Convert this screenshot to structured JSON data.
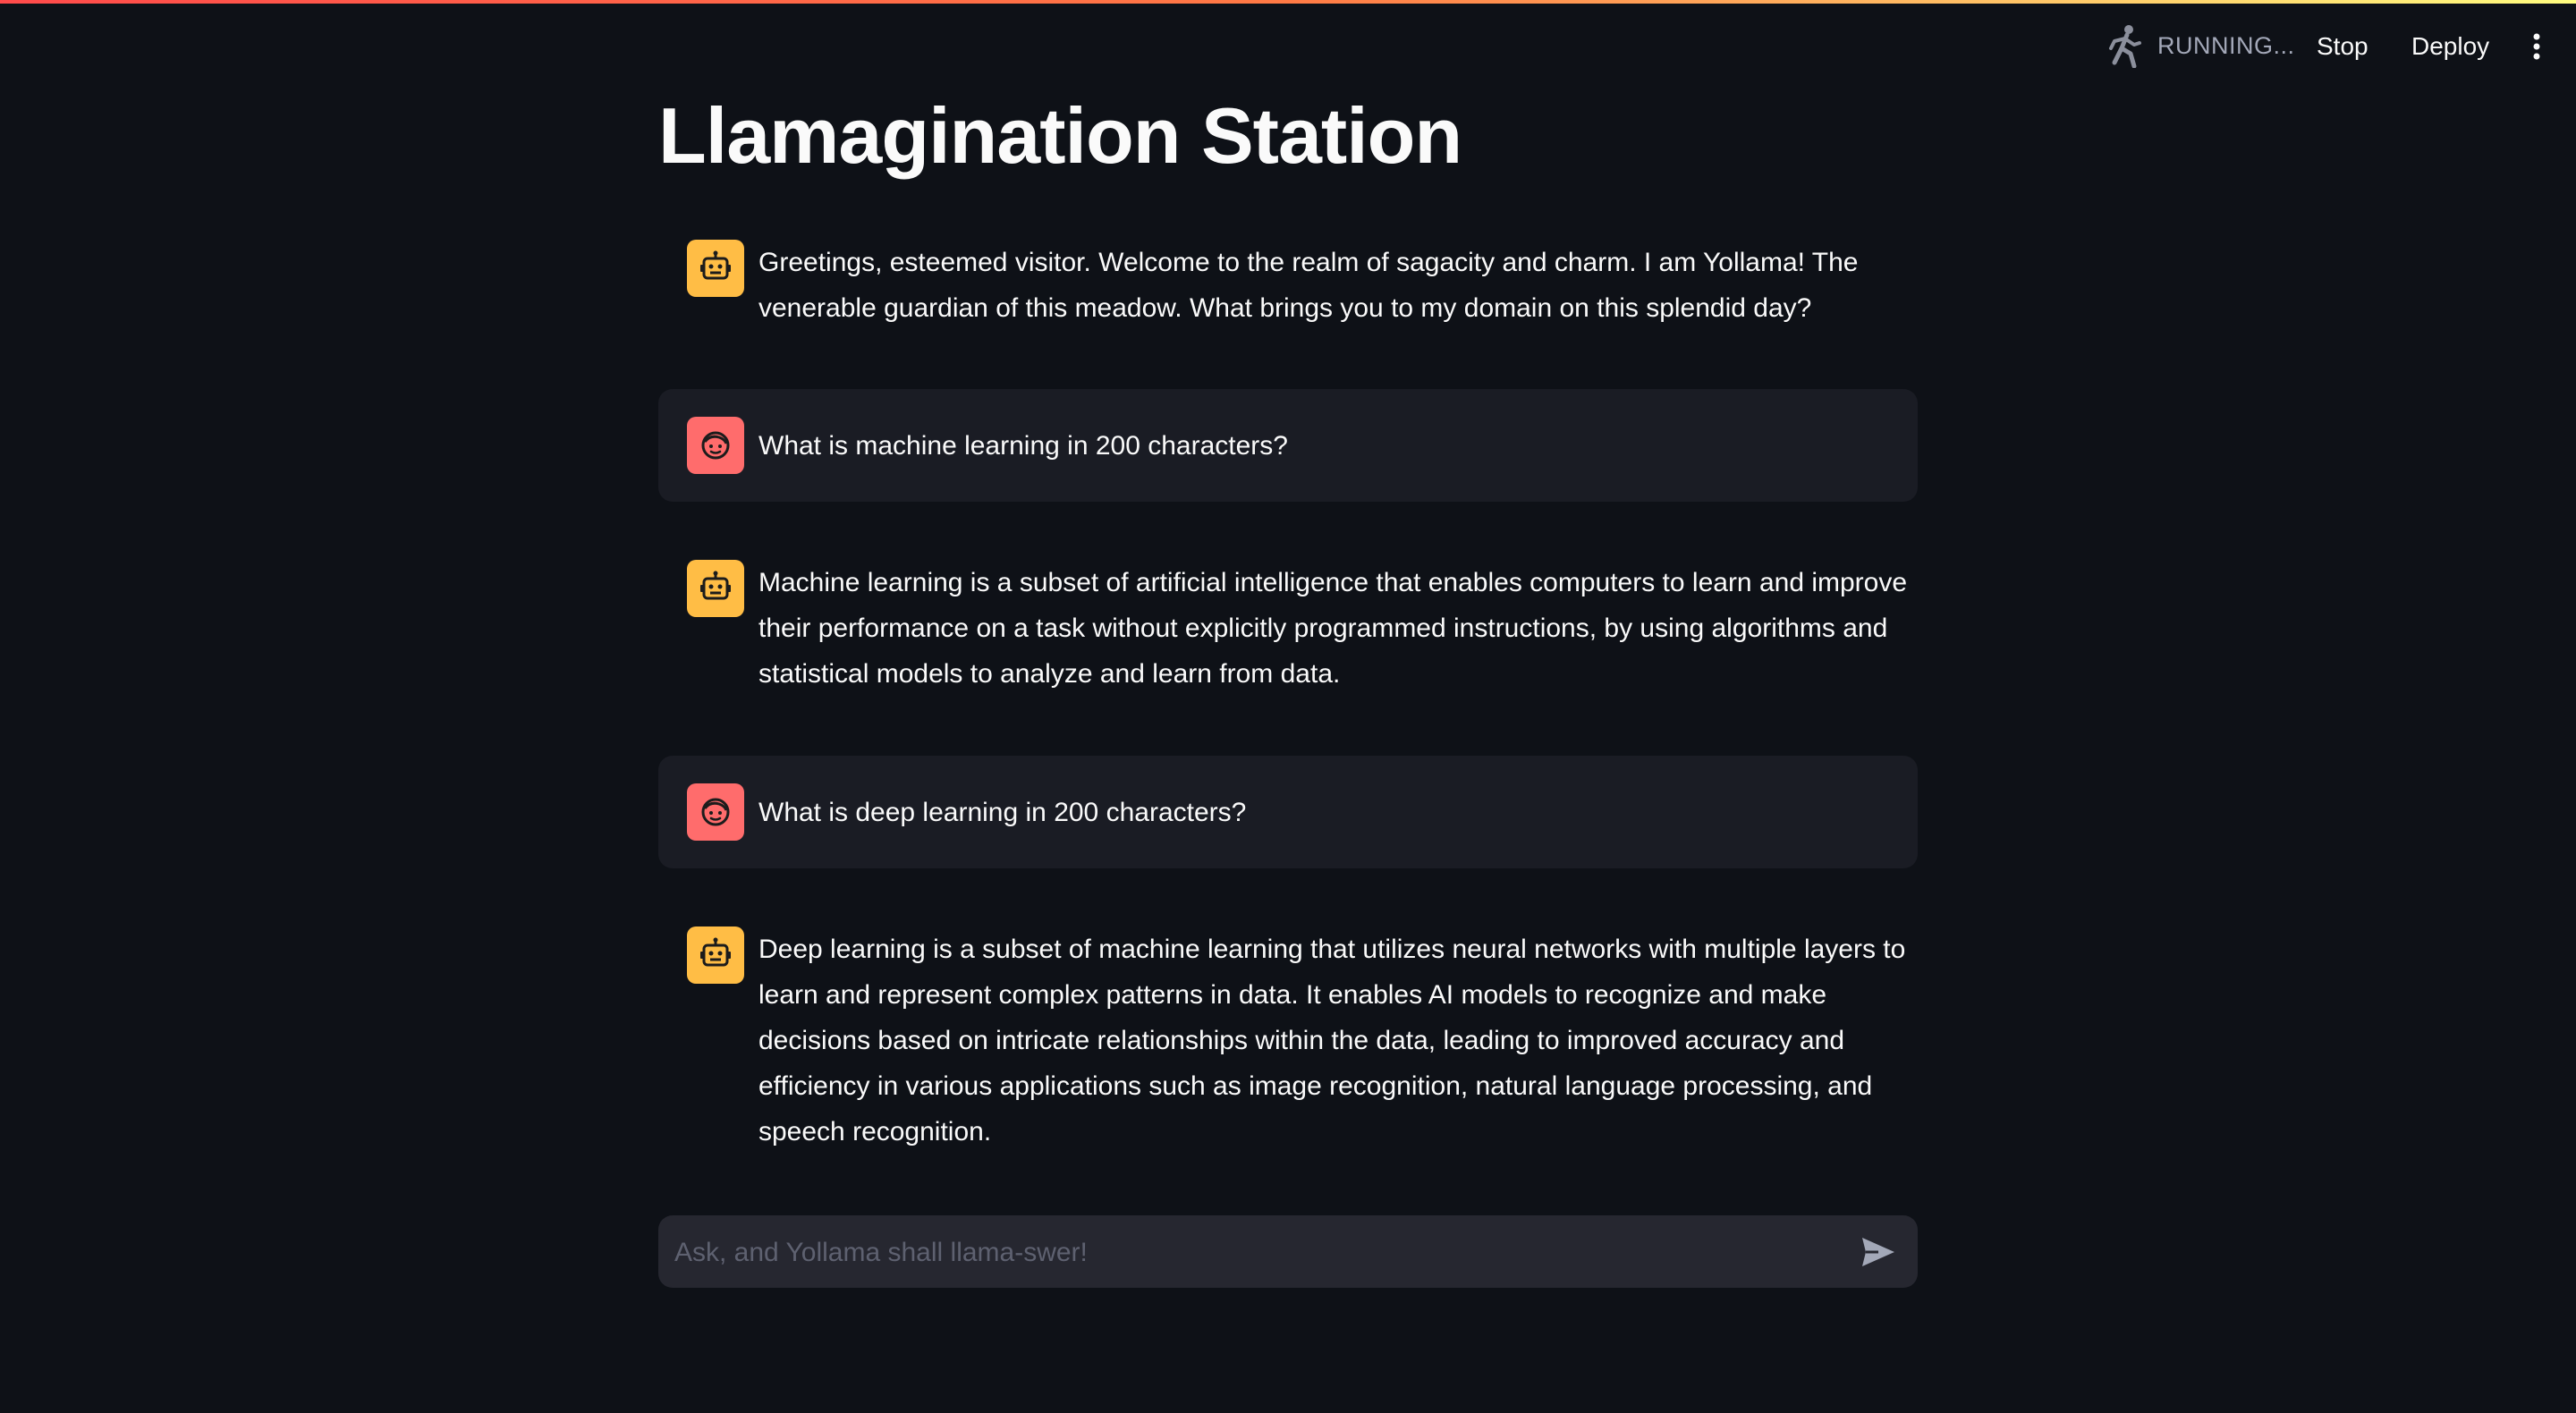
{
  "app": {
    "title": "Llamagination Station",
    "accent": "#ff4b4b",
    "background": "#0e1117"
  },
  "header": {
    "status_text": "RUNNING...",
    "status_icon": "running-figure-icon",
    "stop_label": "Stop",
    "deploy_label": "Deploy",
    "menu_icon": "vertical-dots-icon"
  },
  "messages": [
    {
      "role": "assistant",
      "avatar_icon": "robot-icon",
      "text": "Greetings, esteemed visitor. Welcome to the realm of sagacity and charm. I am Yollama! The venerable guardian of this meadow. What brings you to my domain on this splendid day?"
    },
    {
      "role": "user",
      "avatar_icon": "face-icon",
      "text": "What is machine learning in 200 characters?"
    },
    {
      "role": "assistant",
      "avatar_icon": "robot-icon",
      "text": "Machine learning is a subset of artificial intelligence that enables computers to learn and improve their performance on a task without explicitly programmed instructions, by using algorithms and statistical models to analyze and learn from data."
    },
    {
      "role": "user",
      "avatar_icon": "face-icon",
      "text": "What is deep learning in 200 characters?"
    },
    {
      "role": "assistant",
      "avatar_icon": "robot-icon",
      "text": "Deep learning is a subset of machine learning that utilizes neural networks with multiple layers to learn and represent complex patterns in data. It enables AI models to recognize and make decisions based on intricate relationships within the data, leading to improved accuracy and efficiency in various applications such as image recognition, natural language processing, and speech recognition."
    }
  ],
  "chat_input": {
    "placeholder": "Ask, and Yollama shall llama-swer!",
    "value": "",
    "send_icon": "send-icon"
  },
  "colors": {
    "bot_avatar": "#ffbd45",
    "user_avatar": "#ff6c6c",
    "user_bubble": "#1a1c24",
    "input_bg": "#262730"
  }
}
